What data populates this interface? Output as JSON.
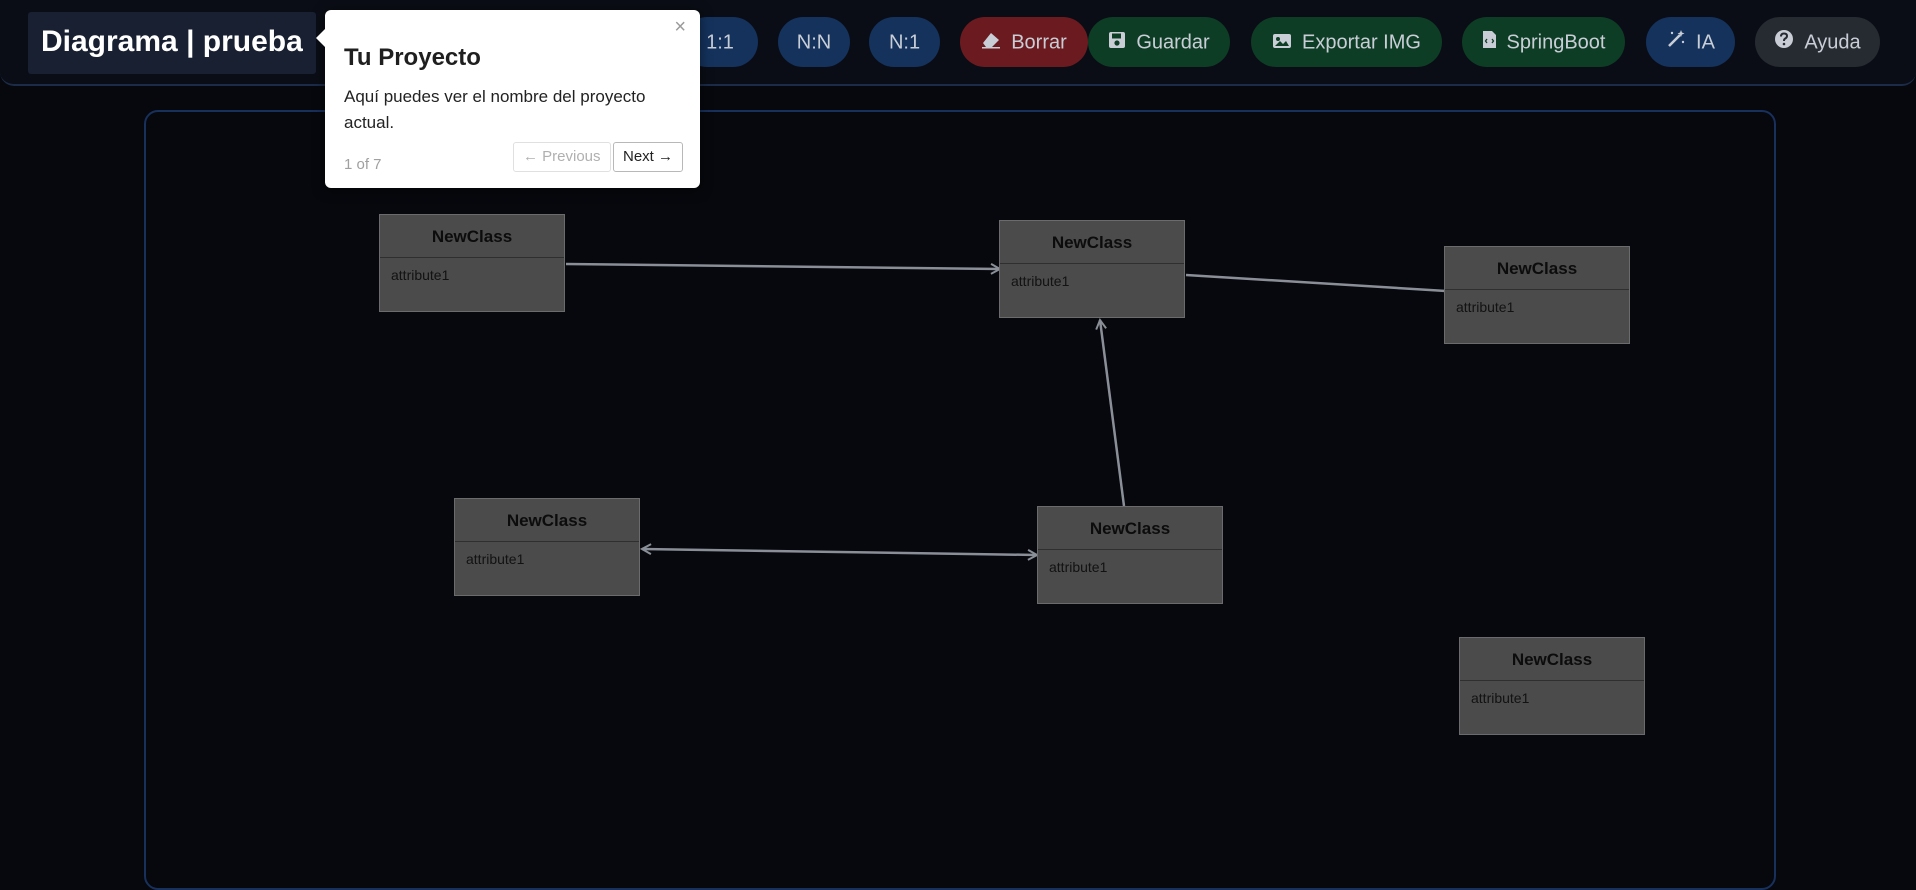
{
  "header": {
    "project_title": "Diagrama | prueba",
    "buttons": [
      {
        "id": "one-to-one",
        "label": "1:1",
        "icon": ""
      },
      {
        "id": "many-to-many",
        "label": "N:N",
        "icon": ""
      },
      {
        "id": "many-to-one",
        "label": "N:1",
        "icon": ""
      },
      {
        "id": "delete",
        "label": "Borrar",
        "icon": "eraser-icon"
      },
      {
        "id": "save",
        "label": "Guardar",
        "icon": "floppy-disk-icon"
      },
      {
        "id": "export-img",
        "label": "Exportar IMG",
        "icon": "image-icon"
      },
      {
        "id": "springboot",
        "label": "SpringBoot",
        "icon": "code-file-icon"
      },
      {
        "id": "ai",
        "label": "IA",
        "icon": "magic-wand-icon"
      },
      {
        "id": "help",
        "label": "Ayuda",
        "icon": "question-circle-icon"
      }
    ]
  },
  "diagram": {
    "classes": [
      {
        "name": "NewClass",
        "attribute": "attribute1"
      },
      {
        "name": "NewClass",
        "attribute": "attribute1"
      },
      {
        "name": "NewClass",
        "attribute": "attribute1"
      },
      {
        "name": "NewClass",
        "attribute": "attribute1"
      },
      {
        "name": "NewClass",
        "attribute": "attribute1"
      },
      {
        "name": "NewClass",
        "attribute": "attribute1"
      }
    ]
  },
  "tour": {
    "title": "Tu Proyecto",
    "text": "Aquí puedes ver el nombre del proyecto actual.",
    "progress": "1 of 7",
    "prev_label": "← Previous",
    "next_label": "Next →",
    "close_label": "×"
  },
  "colors": {
    "background": "#06080d",
    "toolbar_blue": "#14325c",
    "toolbar_red": "#6b1b1f",
    "toolbar_green": "#0e3d25",
    "toolbar_grey": "#262a31",
    "class_box": "#4b4b4b",
    "connector": "#8a8e96"
  }
}
